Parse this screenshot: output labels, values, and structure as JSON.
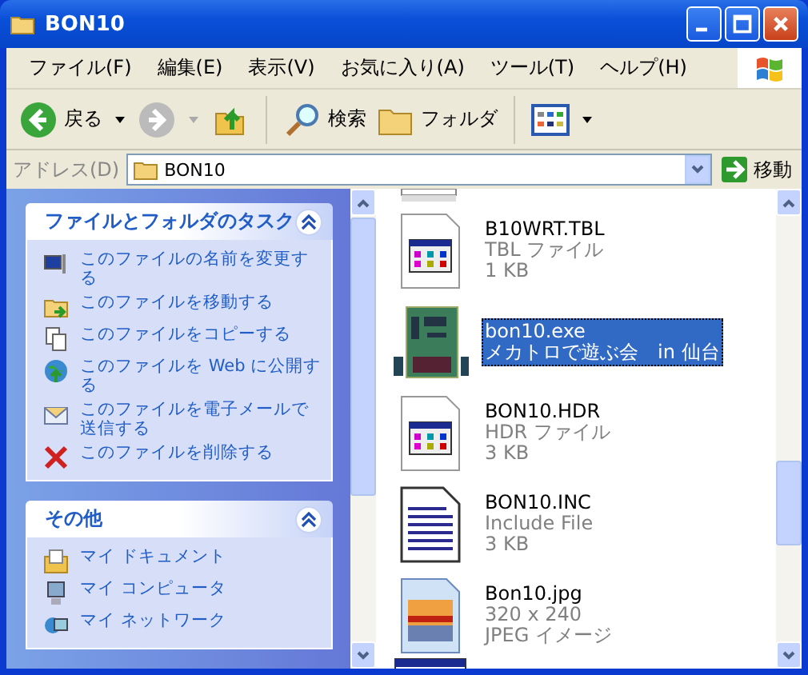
{
  "window": {
    "title": "BON10"
  },
  "menu": [
    "ファイル(F)",
    "編集(E)",
    "表示(V)",
    "お気に入り(A)",
    "ツール(T)",
    "ヘルプ(H)"
  ],
  "toolbar": {
    "back": "戻る",
    "search": "検索",
    "folders": "フォルダ"
  },
  "address": {
    "label": "アドレス(D)",
    "value": "BON10",
    "go": "移動"
  },
  "task_panels": [
    {
      "title": "ファイルとフォルダのタスク",
      "expanded": true,
      "items": [
        {
          "kind": "rename",
          "label": "このファイルの名前を変更する"
        },
        {
          "kind": "move",
          "label": "このファイルを移動する"
        },
        {
          "kind": "copy",
          "label": "このファイルをコピーする"
        },
        {
          "kind": "web",
          "label": "このファイルを Web に公開する"
        },
        {
          "kind": "mail",
          "label": "このファイルを電子メールで送信する"
        },
        {
          "kind": "delete",
          "label": "このファイルを削除する"
        }
      ]
    },
    {
      "title": "その他",
      "expanded": true,
      "items": [
        {
          "kind": "documents",
          "label": "マイ ドキュメント"
        },
        {
          "kind": "computer",
          "label": "マイ コンピュータ"
        },
        {
          "kind": "network",
          "label": "マイ ネットワーク"
        }
      ]
    }
  ],
  "files": [
    {
      "kind": "window",
      "name": "B10WRT.TBL",
      "details": [
        "TBL ファイル",
        "1 KB"
      ],
      "selected": false
    },
    {
      "kind": "board",
      "name": "bon10.exe",
      "details": [
        "メカトロで遊ぶ会　in 仙台"
      ],
      "selected": true
    },
    {
      "kind": "window",
      "name": "BON10.HDR",
      "details": [
        "HDR ファイル",
        "3 KB"
      ],
      "selected": false
    },
    {
      "kind": "text",
      "name": "BON10.INC",
      "details": [
        "Include File",
        "3 KB"
      ],
      "selected": false
    },
    {
      "kind": "image",
      "name": "Bon10.jpg",
      "details": [
        "320 x 240",
        "JPEG イメージ"
      ],
      "selected": false
    }
  ]
}
